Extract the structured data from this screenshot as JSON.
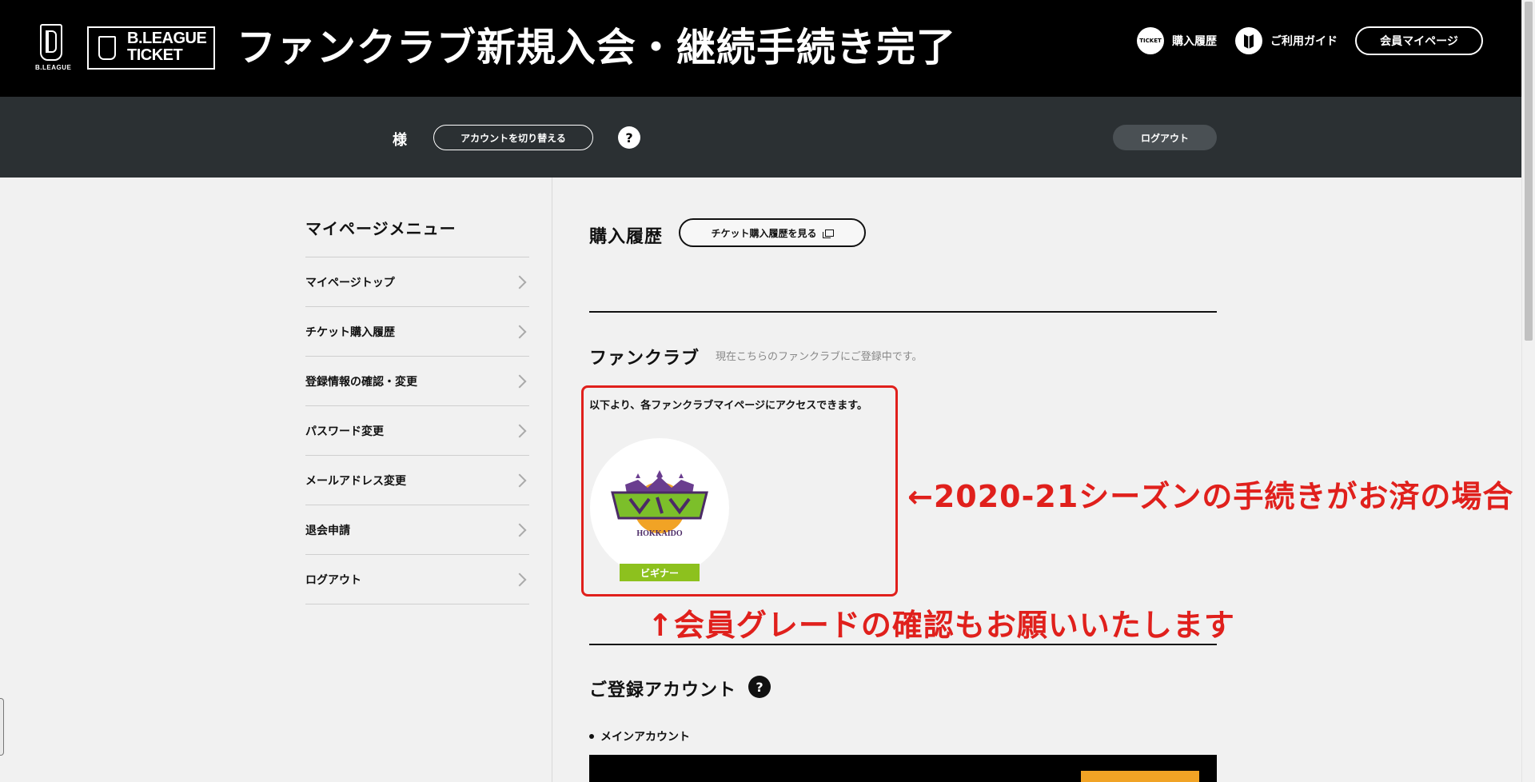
{
  "header": {
    "bleague_label": "B.LEAGUE",
    "ticket_logo_line1": "B.LEAGUE",
    "ticket_logo_line2": "TICKET",
    "title": "ファンクラブ新規入会・継続手続き完了",
    "purchase_history_link": "購入履歴",
    "purchase_history_icon_text": "TICKET",
    "guide_link": "ご利用ガイド",
    "mypage_button": "会員マイページ"
  },
  "subheader": {
    "honorific": "様",
    "switch_account_button": "アカウントを切り替える",
    "help_mark": "?",
    "logout_button": "ログアウト"
  },
  "menu": {
    "title": "マイページメニュー",
    "items": [
      "マイページトップ",
      "チケット購入履歴",
      "登録情報の確認・変更",
      "パスワード変更",
      "メールアドレス変更",
      "退会申請",
      "ログアウト"
    ]
  },
  "purchase": {
    "title": "購入履歴",
    "button": "チケット購入履歴を見る"
  },
  "fanclub": {
    "title": "ファンクラブ",
    "note": "現在こちらのファンクラブにご登録中です。",
    "access_text": "以下より、各ファンクラブマイページにアクセスできます。",
    "team_logo_text": "HOKKAIDO",
    "grade": "ビギナー"
  },
  "annotations": {
    "right": "←2020-21シーズンの手続きがお済の場合",
    "below": "↑会員グレードの確認もお願いいたします"
  },
  "account": {
    "title": "ご登録アカウント",
    "help_mark": "?",
    "main_account": "メインアカウント"
  },
  "colors": {
    "header_bg": "#000000",
    "subheader_bg": "#2b3033",
    "annotation_red": "#e0201c",
    "grade_green": "#8dc11e"
  }
}
